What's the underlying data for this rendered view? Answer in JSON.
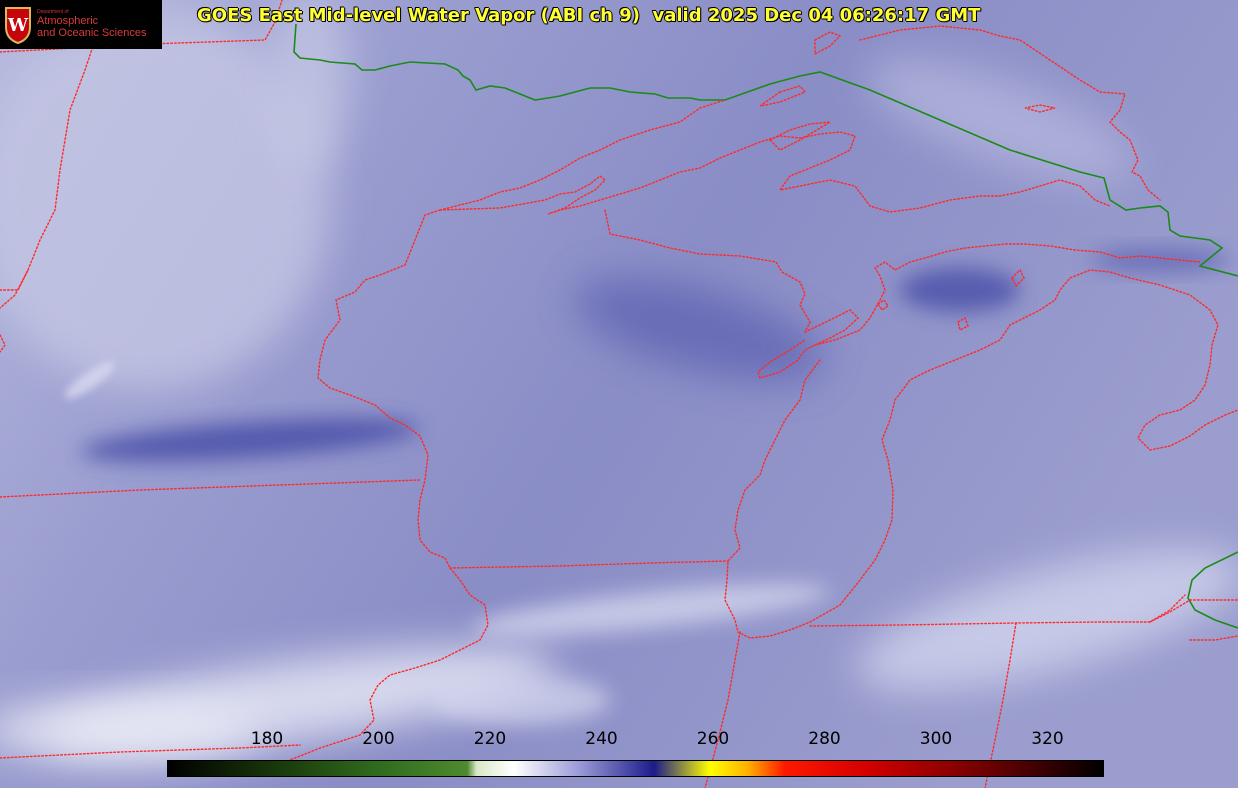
{
  "title": "GOES East Mid-level Water Vapor (ABI ch 9)  valid 2025 Dec 04 06:26:17 GMT",
  "logo": {
    "dept": "Department of",
    "line1": "Atmospheric",
    "line2": "and Oceanic Sciences",
    "seal_letter": "W"
  },
  "colorbar": {
    "ticks": [
      "180",
      "200",
      "220",
      "240",
      "260",
      "280",
      "300",
      "320"
    ],
    "gradient": [
      "#000000",
      "#1a3a0a",
      "#2e6a1e",
      "#4e8a2e",
      "#d8e8c8",
      "#ffffff",
      "#9a9ad8",
      "#1c1c8a",
      "#ffff00",
      "#ffb000",
      "#ff1800",
      "#d00000",
      "#6a0000",
      "#000000"
    ]
  },
  "colors": {
    "state_border": "#ff2a2a",
    "country_border": "#1a8a1a",
    "imagery_base": "#8a8ec4",
    "dry_band": "#4a4fa8",
    "moist_cloud": "#e6e8f4",
    "title": "#ffff33"
  }
}
